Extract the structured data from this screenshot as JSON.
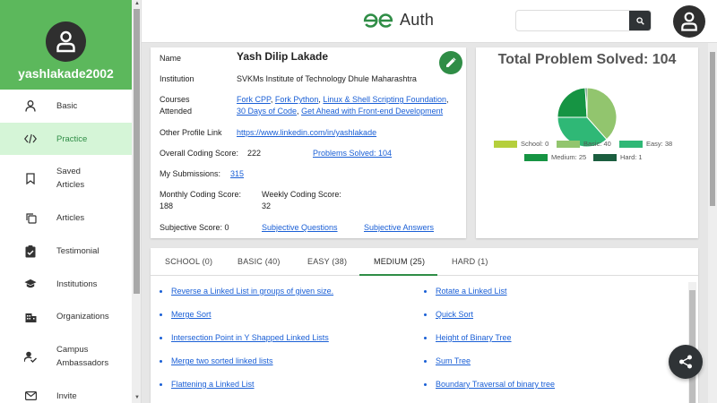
{
  "sidebar": {
    "username": "yashlakade2002",
    "items": [
      {
        "label": "Basic",
        "icon": "person-icon"
      },
      {
        "label": "Practice",
        "icon": "code-icon"
      },
      {
        "label": "Saved\nArticles",
        "icon": "bookmark-icon"
      },
      {
        "label": "Articles",
        "icon": "copy-icon"
      },
      {
        "label": "Testimonial",
        "icon": "clipboard-check-icon"
      },
      {
        "label": "Institutions",
        "icon": "school-icon"
      },
      {
        "label": "Organizations",
        "icon": "building-icon"
      },
      {
        "label": "Campus\nAmbassadors",
        "icon": "person-check-icon"
      },
      {
        "label": "Invite",
        "icon": "mail-icon"
      }
    ]
  },
  "header": {
    "logo_text": "Auth",
    "search_placeholder": ""
  },
  "profile": {
    "name_label": "Name",
    "name": "Yash Dilip Lakade",
    "institution_label": "Institution",
    "institution": "SVKMs Institute of Technology Dhule Maharashtra",
    "courses_label_1": "Courses",
    "courses_label_2": "Attended",
    "courses": [
      "Fork CPP",
      "Fork Python",
      "Linux & Shell Scripting Foundation",
      "30 Days of Code",
      "Get Ahead with Front-end Development"
    ],
    "other_profile_label": "Other Profile Link",
    "other_profile": "https://www.linkedin.com/in/yashlakade",
    "overall_score_label": "Overall Coding Score:",
    "overall_score": "222",
    "problems_solved_link": "Problems Solved: 104",
    "submissions_label": "My Submissions:",
    "submissions": "315",
    "monthly_label": "Monthly Coding Score:",
    "monthly": "188",
    "weekly_label": "Weekly Coding Score:",
    "weekly": "32",
    "subjective_label": "Subjective Score: 0",
    "subjective_questions": "Subjective Questions",
    "subjective_answers": "Subjective Answers"
  },
  "chart_data": {
    "type": "pie",
    "title": "Total Problem Solved: 104",
    "categories": [
      "School",
      "Basic",
      "Easy",
      "Medium",
      "Hard"
    ],
    "values": [
      0,
      40,
      38,
      25,
      1
    ],
    "legend_labels": [
      "School: 0",
      "Basic: 40",
      "Easy: 38",
      "Medium: 25",
      "Hard: 1"
    ],
    "colors": [
      "#b5cf3c",
      "#92c56e",
      "#2fb876",
      "#169443",
      "#1b5e3f"
    ],
    "legend_placement": "bottom"
  },
  "tabs": [
    "SCHOOL (0)",
    "BASIC (40)",
    "EASY (38)",
    "MEDIUM (25)",
    "HARD (1)"
  ],
  "active_tab": 3,
  "problems_left": [
    "Reverse a Linked List in groups of given size.",
    "Merge Sort",
    "Intersection Point in Y Shapped Linked Lists",
    "Merge two sorted linked lists",
    "Flattening a Linked List"
  ],
  "problems_right": [
    "Rotate a Linked List",
    "Quick Sort",
    "Height of Binary Tree",
    "Sum Tree",
    "Boundary Traversal of binary tree"
  ],
  "colors": {
    "brand": "#2f8d46",
    "sidebar_head": "#5cb85c",
    "active_bg": "#d5f5d7",
    "link": "#1a5fd6"
  }
}
